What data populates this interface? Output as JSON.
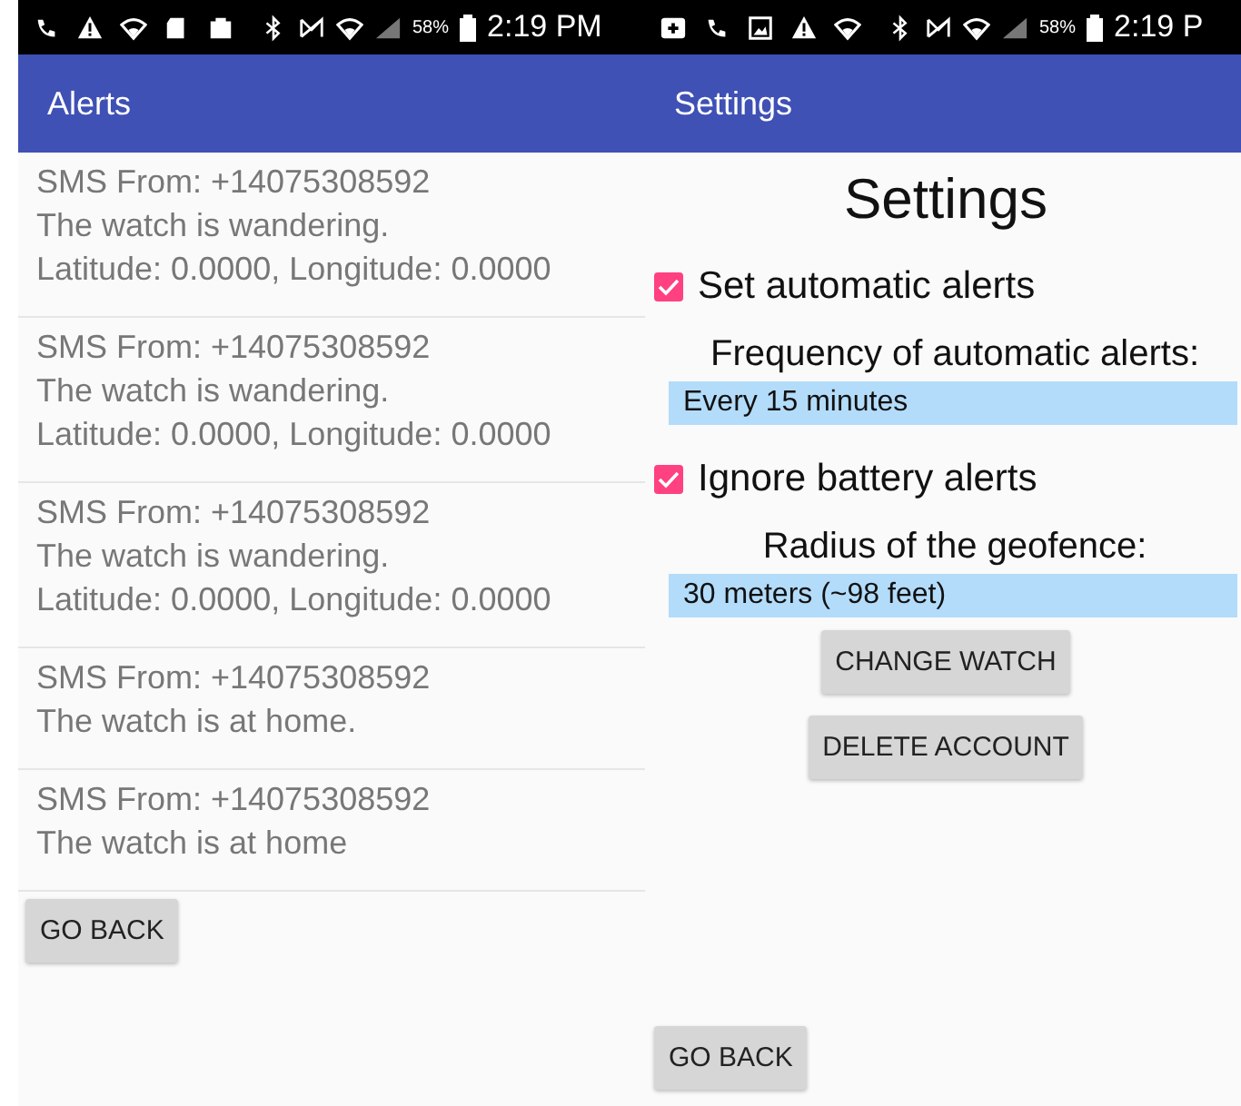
{
  "phones": [
    {
      "kind": "alerts",
      "status_bar": {
        "battery": "58%",
        "time": "2:19 PM"
      },
      "app_bar": {
        "title": "Alerts"
      },
      "alerts": [
        {
          "sender": "SMS From: +14075308592",
          "message": "The watch is wandering.",
          "location": "Latitude: 0.0000, Longitude: 0.0000"
        },
        {
          "sender": "SMS From: +14075308592",
          "message": "The watch is wandering.",
          "location": "Latitude: 0.0000, Longitude: 0.0000"
        },
        {
          "sender": "SMS From: +14075308592",
          "message": "The watch is wandering.",
          "location": "Latitude: 0.0000, Longitude: 0.0000"
        },
        {
          "sender": "SMS From: +14075308592",
          "message": "The watch is at home."
        },
        {
          "sender": "SMS From: +14075308592",
          "message": "The watch is at home"
        }
      ],
      "footer_button": "GO BACK"
    },
    {
      "kind": "settings",
      "status_bar": {
        "battery": "58%",
        "time": "2:19 P"
      },
      "app_bar": {
        "title": "Settings"
      },
      "heading": "Settings",
      "settings": [
        {
          "kind": "checkbox",
          "label": "Set automatic alerts",
          "checked": true
        },
        {
          "kind": "dropdown",
          "label": "Frequency of automatic alerts:",
          "value": "Every 15 minutes"
        },
        {
          "kind": "checkbox",
          "label": "Ignore battery alerts",
          "checked": true
        },
        {
          "kind": "dropdown",
          "label": "Radius of the geofence:",
          "value": "30 meters (~98 feet)"
        }
      ],
      "buttons": [
        "CHANGE WATCH",
        "DELETE ACCOUNT"
      ],
      "footer_button": "GO BACK"
    }
  ]
}
